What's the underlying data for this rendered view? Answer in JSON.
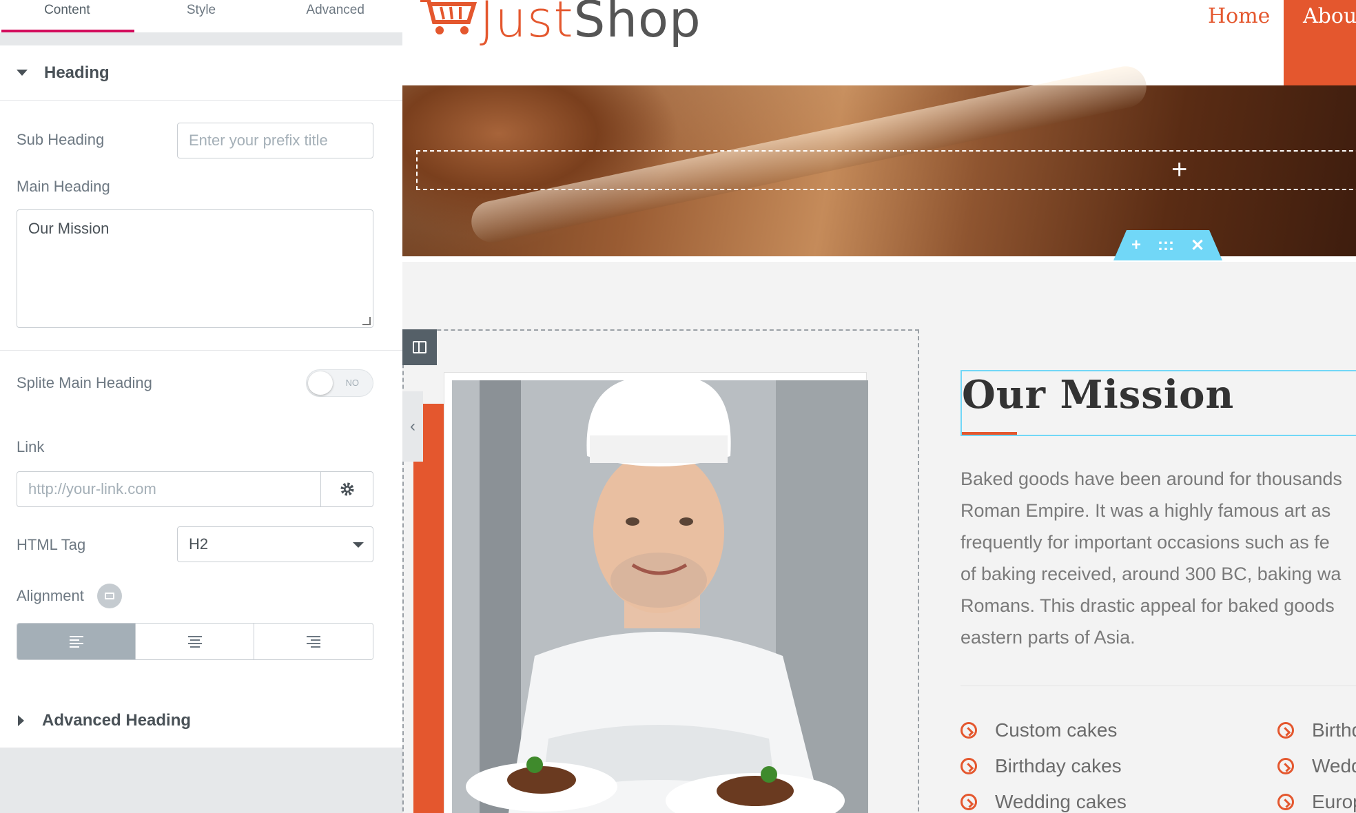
{
  "panel": {
    "tabs": [
      "Content",
      "Style",
      "Advanced"
    ],
    "heading_section": {
      "title": "Heading",
      "sub_heading_label": "Sub Heading",
      "sub_heading_placeholder": "Enter your prefix title",
      "main_heading_label": "Main Heading",
      "main_heading_value": "Our Mission",
      "split_label": "Splite Main Heading",
      "split_toggle_text": "NO",
      "link_label": "Link",
      "link_placeholder": "http://your-link.com",
      "html_tag_label": "HTML Tag",
      "html_tag_value": "H2",
      "alignment_label": "Alignment",
      "alignment_selected": "left"
    },
    "advanced_section": {
      "title": "Advanced Heading"
    }
  },
  "preview": {
    "logo": {
      "part1": "Just",
      "part2": "Shop"
    },
    "nav": [
      "Home",
      "About"
    ],
    "hero_plus": "+",
    "hero_toolbar": [
      "+",
      ":::",
      "✕"
    ],
    "mission_title": "Our Mission",
    "mission_text": "Baked goods have been around for thousands\nRoman Empire. It was a highly famous art as\nfrequently for important occasions such as fe\nof baking received, around 300 BC, baking wa\nRomans. This drastic appeal for baked goods\neastern parts of Asia.",
    "features_col1": [
      "Custom cakes",
      "Birthday cakes",
      "Wedding cakes"
    ],
    "features_col2": [
      "Birthd",
      "Wedd",
      "Europ"
    ],
    "collapse_arrow": "‹"
  },
  "colors": {
    "accent": "#e4572e",
    "editor_pink": "#d30c5c",
    "selection_blue": "#71d7f7"
  }
}
